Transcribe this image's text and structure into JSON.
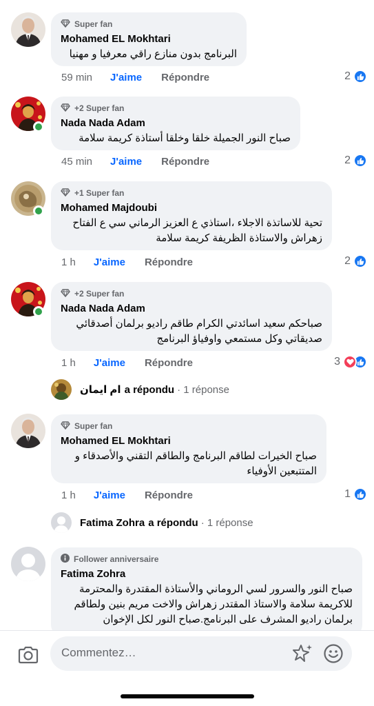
{
  "comments": [
    {
      "badge": "Super fan",
      "author": "Mohamed EL Mokhtari",
      "text": "البرنامج بدون منازع راقي معرفيا و مهنيا",
      "time": "59 min",
      "like": "J'aime",
      "reply": "Répondre",
      "reactions": "2",
      "avatar_colors": {
        "bg": "#e9e3dd",
        "coat": "#2d2a2b",
        "face": "#d9b49a"
      }
    },
    {
      "badge": "+2 Super fan",
      "author": "Nada Nada Adam",
      "text": "صباح النور الجميلة خلقا وخلقا أستاذة كريمة سلامة",
      "time": "45 min",
      "like": "J'aime",
      "reply": "Répondre",
      "reactions": "2",
      "avatar_colors": {
        "bg": "#c8151b",
        "coat": "#2a1b10",
        "face": "#e0a34a"
      }
    },
    {
      "badge": "+1 Super fan",
      "author": "Mohamed Majdoubi",
      "text": "تحية للاساتذة الاجلاء ،استاذي ع العزيز الرماني سي ع الفتاح زهراش والاستاذة الظريفة كريمة سلامة",
      "time": "1 h",
      "like": "J'aime",
      "reply": "Répondre",
      "reactions": "2",
      "avatar_colors": {
        "bg": "#c9b58e",
        "coat": "#8a7046",
        "face": "#e7d6b3"
      }
    },
    {
      "badge": "+2 Super fan",
      "author": "Nada Nada Adam",
      "text": "صباحكم سعيد اسائدتي الكرام طاقم راديو برلمان أصدقائي صديقاتي وكل مستمعي واوفياؤ البرنامج",
      "time": "1 h",
      "like": "J'aime",
      "reply": "Répondre",
      "reactions": "3",
      "avatar_colors": {
        "bg": "#c8151b",
        "coat": "#2a1b10",
        "face": "#e0a34a"
      }
    },
    {
      "badge": "Super fan",
      "author": "Mohamed EL Mokhtari",
      "text": "صباح الخيرات لطاقم البرنامج والطاقم التقني والأصدقاء و المتتبعين الأوفياء",
      "time": "1 h",
      "like": "J'aime",
      "reply": "Répondre",
      "reactions": "1",
      "avatar_colors": {
        "bg": "#e9e3dd",
        "coat": "#2d2a2b",
        "face": "#d9b49a"
      }
    },
    {
      "badge": "Follower anniversaire",
      "author": "Fatima Zohra",
      "text": "صباح النور والسرور لسي الروماني والأستاذة المقتدرة والمحترمة للاكريمة سلامة والاستاذ المقتدر زهراش والاخت مريم بنين ولطاقم برلمان راديو المشرف على البرنامج.صباح النور لكل الإخوان"
    }
  ],
  "replies": [
    {
      "name": "ام ايمان",
      "action": "a répondu",
      "count": "· 1 réponse"
    },
    {
      "name": "Fatima Zohra",
      "action": "a répondu",
      "count": "· 1 réponse"
    }
  ],
  "composer": {
    "placeholder": "Commentez…"
  },
  "colors": {
    "accent": "#0866ff",
    "online": "#31a24c",
    "bubble": "#f0f2f5",
    "like": "#1877f2",
    "love": "#f33e58"
  }
}
